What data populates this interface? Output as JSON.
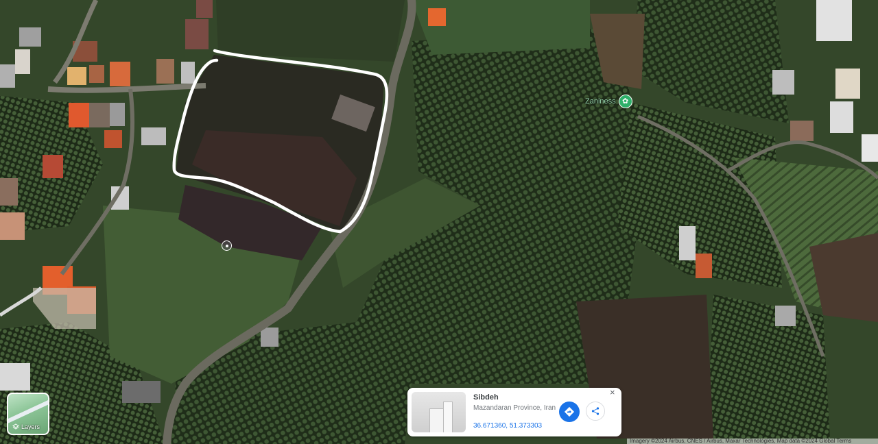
{
  "map": {
    "place_label": "Zaniness",
    "place_icon": "park-icon"
  },
  "layers_button": {
    "label": "Layers",
    "icon": "layers-icon"
  },
  "info_card": {
    "title": "Sibdeh",
    "subtitle": "Mazandaran Province, Iran",
    "coordinates": "36.671360, 51.373303",
    "directions_icon": "directions-icon",
    "share_icon": "share-icon",
    "close_symbol": "×"
  },
  "attribution": "Imagery ©2024 Airbus, CNES / Airbus, Maxar Technologies, Map data ©2024   Global   Terms",
  "colors": {
    "annotation_outline": "#ffffff",
    "link_blue": "#1a73e8",
    "place_green": "#2fb06a"
  }
}
